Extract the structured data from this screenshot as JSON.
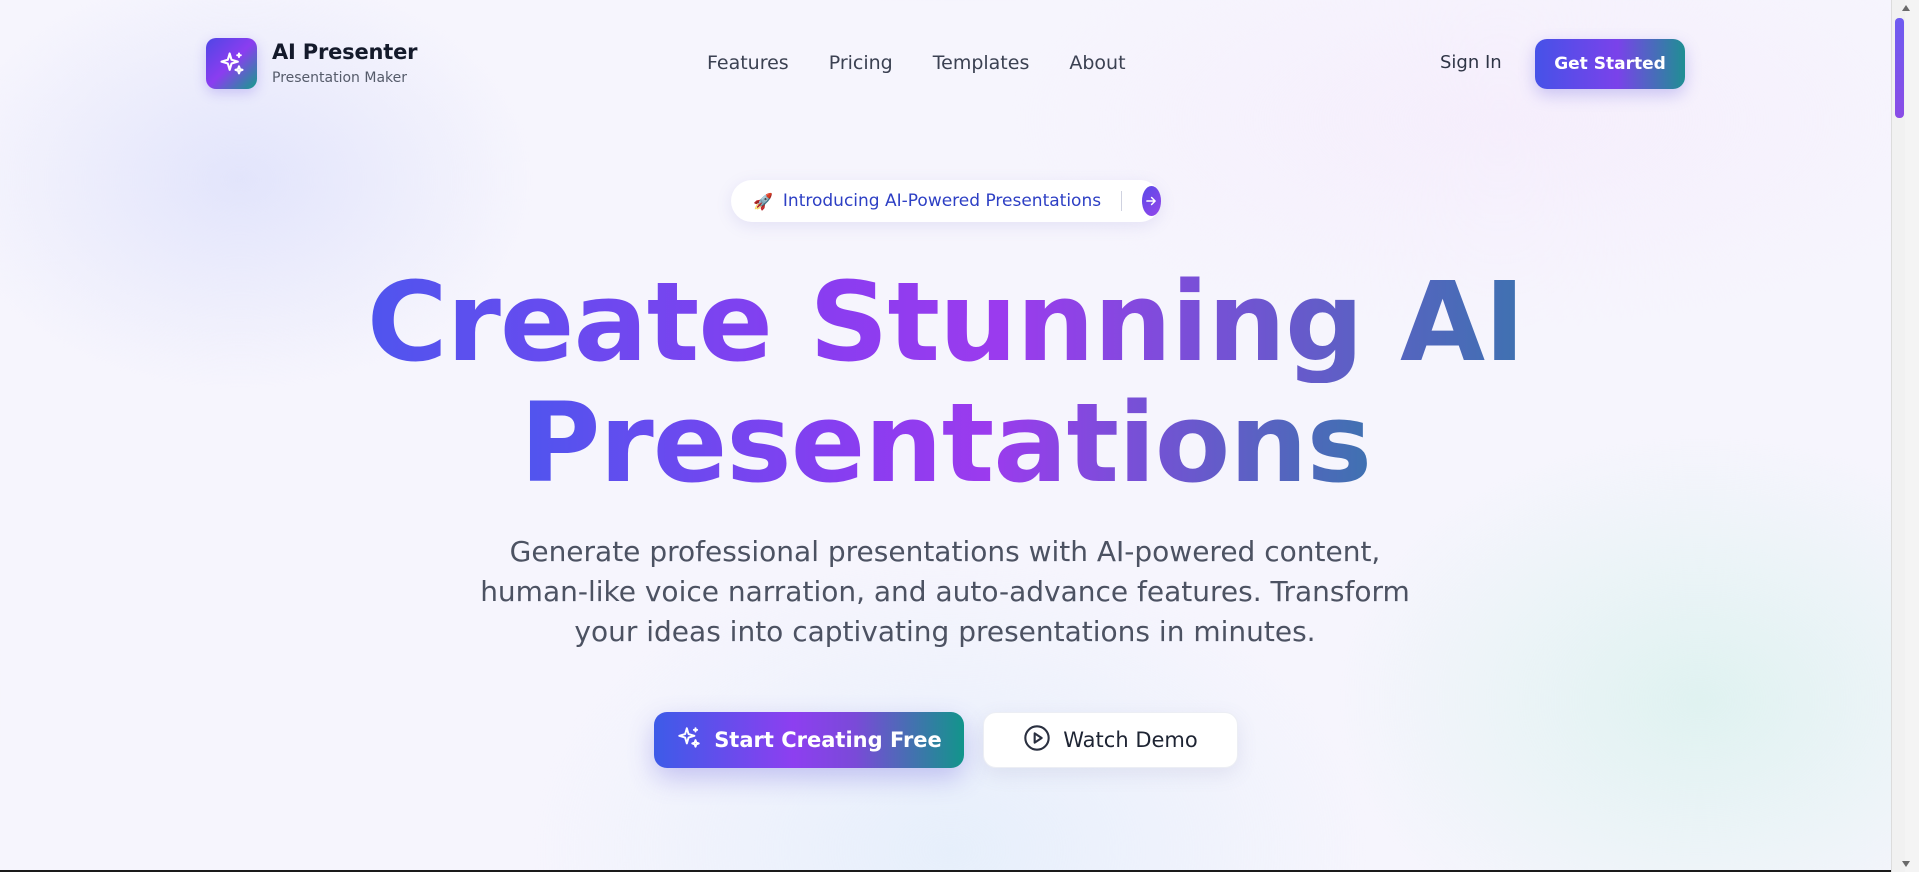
{
  "brand": {
    "name": "AI Presenter",
    "subtitle": "Presentation Maker",
    "logo_icon": "sparkles-icon"
  },
  "nav": {
    "items": [
      {
        "label": "Features"
      },
      {
        "label": "Pricing"
      },
      {
        "label": "Templates"
      },
      {
        "label": "About"
      }
    ]
  },
  "header_actions": {
    "sign_in": "Sign In",
    "get_started": "Get Started"
  },
  "announcement": {
    "emoji": "🚀",
    "text": "Introducing AI-Powered Presentations",
    "arrow_icon": "arrow-right-icon"
  },
  "hero": {
    "headline_line1": "Create Stunning AI",
    "headline_line2": "Presentations",
    "description": "Generate professional presentations with AI-powered content, human-like voice narration, and auto-advance features. Transform your ideas into captivating presentations in minutes.",
    "primary_cta": "Start Creating Free",
    "primary_cta_icon": "sparkles-icon",
    "secondary_cta": "Watch Demo",
    "secondary_cta_icon": "play-circle-icon"
  },
  "colors": {
    "brand_indigo": "#4f46e5",
    "brand_purple": "#8b3df0",
    "brand_teal": "#149e8a",
    "announcement_text": "#2d3fc4"
  }
}
